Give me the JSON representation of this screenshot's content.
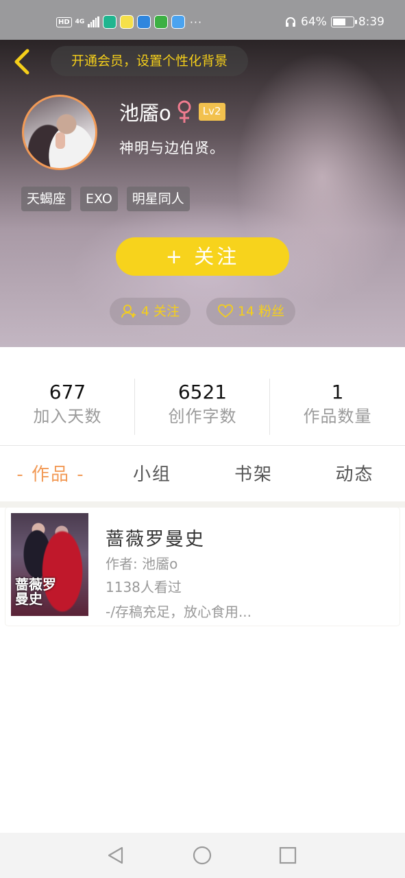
{
  "status_bar": {
    "hd": "HD",
    "network": "4G",
    "more": "···",
    "battery_percent": "64%",
    "battery_level": 0.64,
    "time": "8:39",
    "app_icons": [
      "app-green-icon",
      "app-yellow-icon",
      "app-blue-icon",
      "app-video-icon",
      "app-cloud-icon"
    ]
  },
  "header": {
    "vip_banner": "开通会员，设置个性化背景",
    "username": "池靥o",
    "gender_symbol": "♀",
    "level": "Lv2",
    "bio": "神明与边伯贤。",
    "tags": [
      "天蝎座",
      "EXO",
      "明星同人"
    ],
    "follow_button": "+  关注",
    "following": "4 关注",
    "fans": "14 粉丝",
    "colors": {
      "accent_yellow": "#f7d31c",
      "avatar_border": "#f29a56",
      "gender_pink": "#f07c8f"
    }
  },
  "stats": [
    {
      "value": "677",
      "label": "加入天数"
    },
    {
      "value": "6521",
      "label": "创作字数"
    },
    {
      "value": "1",
      "label": "作品数量"
    }
  ],
  "tabs": [
    {
      "label": "- 作品 -",
      "active": true
    },
    {
      "label": "小组",
      "active": false
    },
    {
      "label": "书架",
      "active": false
    },
    {
      "label": "动态",
      "active": false
    }
  ],
  "books": [
    {
      "title": "蔷薇罗曼史",
      "author": "作者: 池靥o",
      "views": "1138人看过",
      "description": "-/存稿充足，放心食用...",
      "cover_text": "蔷薇罗曼史"
    }
  ],
  "nav": {
    "icons": [
      "back-triangle-icon",
      "home-circle-icon",
      "recents-square-icon"
    ]
  }
}
